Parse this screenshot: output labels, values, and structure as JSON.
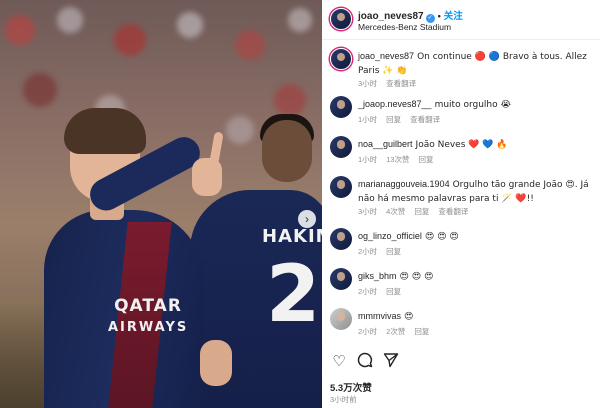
{
  "header": {
    "username": "joao_neves87",
    "follow_label": "关注",
    "location": "Mercedes-Benz Stadium"
  },
  "photo": {
    "sponsor_line1": "QATAR",
    "sponsor_line2": "AIRWAYS",
    "player2_name": "HAKIM",
    "player2_number": "2"
  },
  "comments": [
    {
      "user": "joao_neves87",
      "text": "On continue 🔴 🔵 Bravo à tous. Allez Paris ✨ 👏",
      "time": "3小时",
      "actions": [
        "查看翻译"
      ]
    },
    {
      "user": "_joaop.neves87__",
      "text": "muito orgulho 😭",
      "time": "1小时",
      "actions": [
        "回复",
        "查看翻译"
      ]
    },
    {
      "user": "noa__guilbert",
      "text": "João Neves ❤️ 💙 🔥",
      "time": "1小时",
      "actions": [
        "13次赞",
        "回复"
      ]
    },
    {
      "user": "marianaggouveia.1904",
      "text": "Orgulho tão grande João 😍. Já não há mesmo palavras para ti 🪄 ❤️!!",
      "time": "3小时",
      "actions": [
        "4次赞",
        "回复",
        "查看翻译"
      ]
    },
    {
      "user": "og_linzo_officiel",
      "text": "😍 😍 😍",
      "time": "2小时",
      "actions": [
        "回复"
      ]
    },
    {
      "user": "giks_bhm",
      "text": "😍 😍 😍",
      "time": "2小时",
      "actions": [
        "回复"
      ]
    },
    {
      "user": "mmmvivas",
      "text": "😍",
      "time": "2小时",
      "actions": [
        "2次赞",
        "回复"
      ]
    }
  ],
  "actions": {
    "like_icon": "heart-outline",
    "comment_icon": "comment-bubble",
    "share_icon": "paper-plane"
  },
  "post": {
    "likes": "5.3万次赞",
    "time": "3小时前"
  }
}
